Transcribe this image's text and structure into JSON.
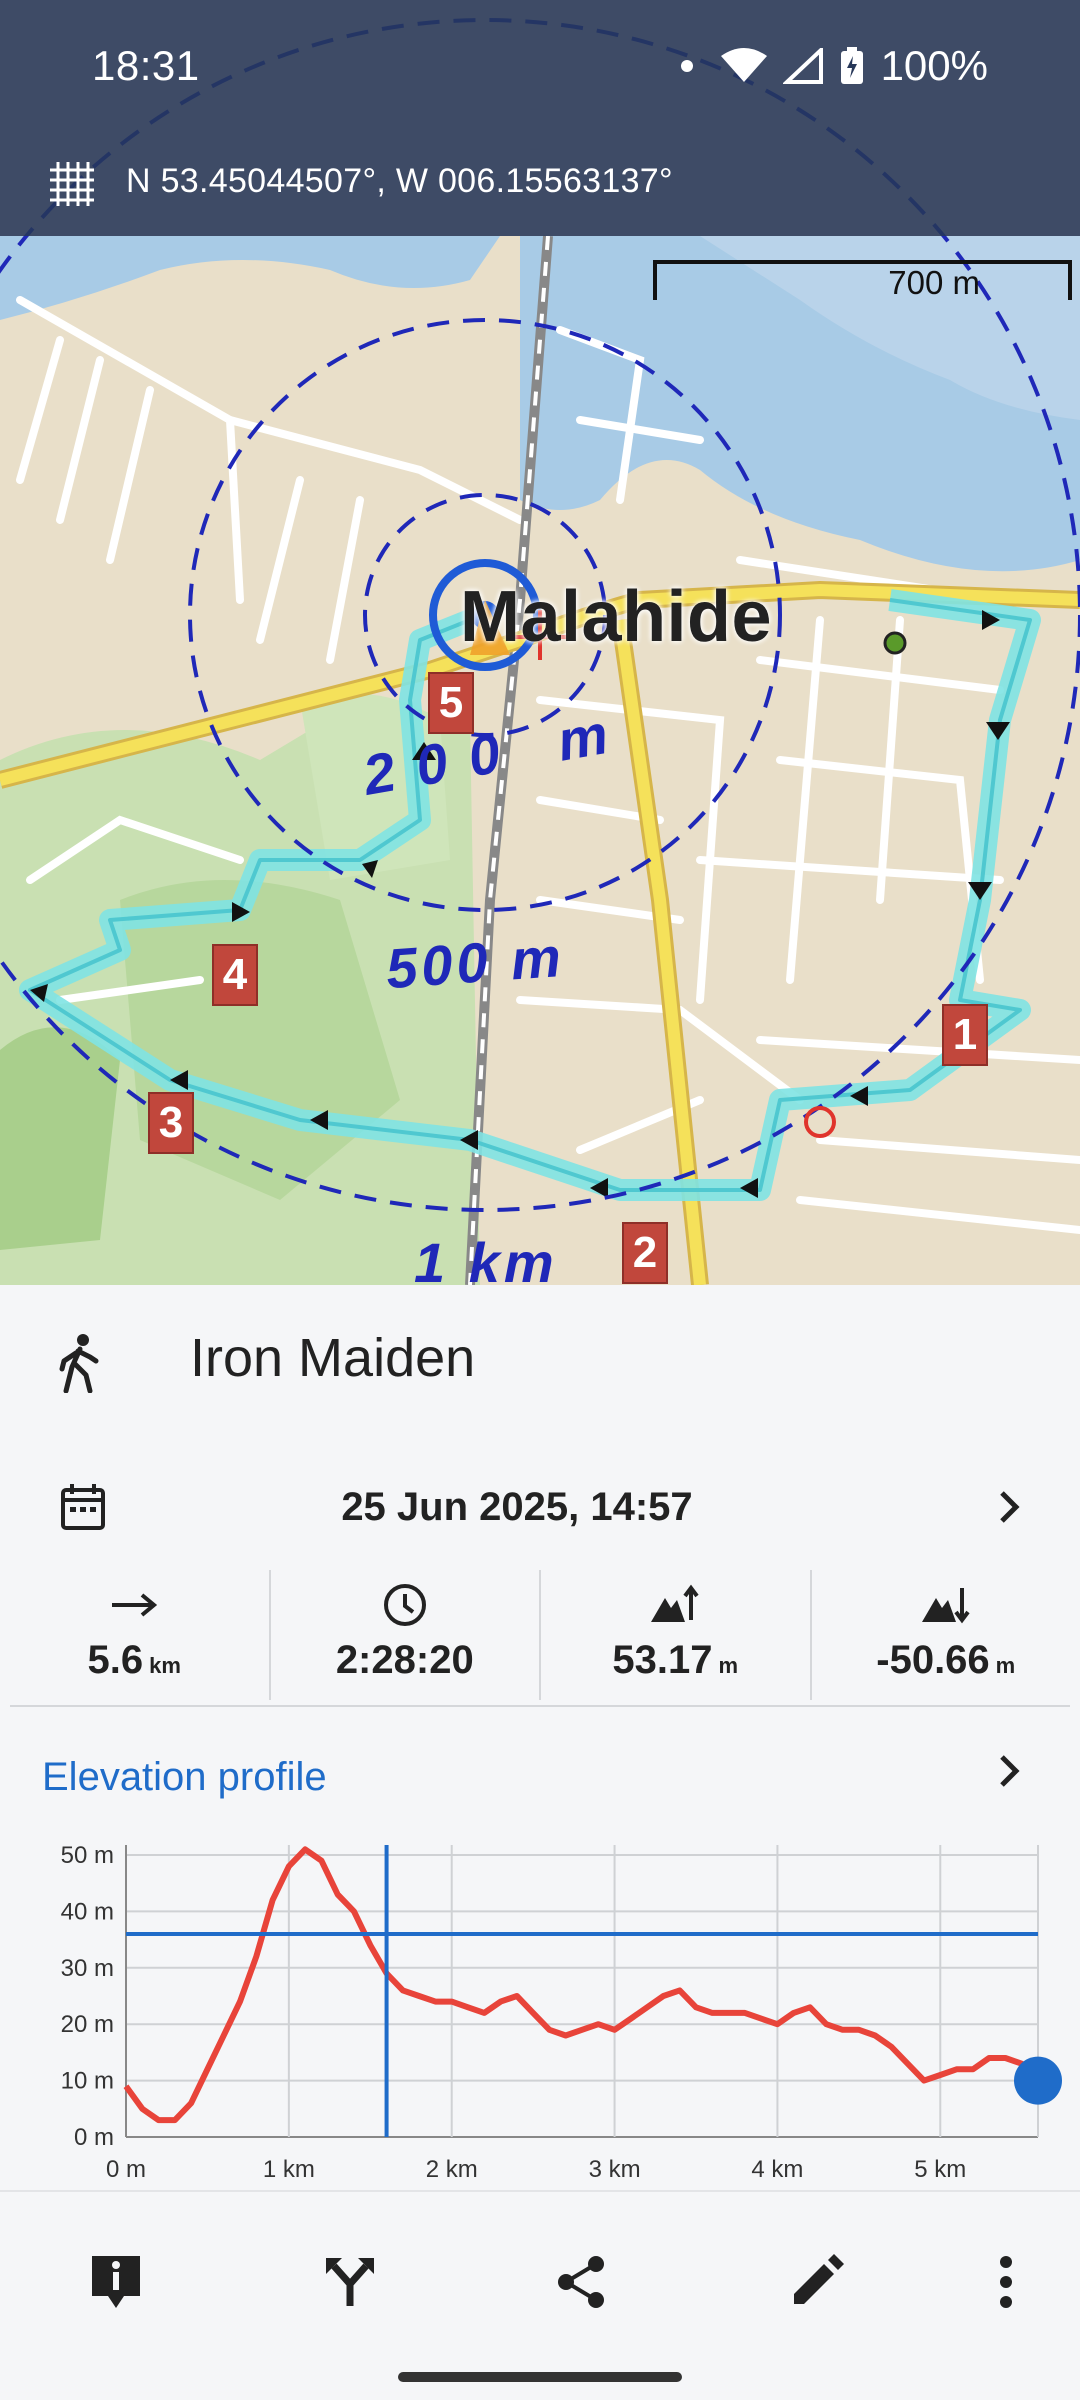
{
  "status_bar": {
    "time": "18:31",
    "battery": "100%"
  },
  "coordinates": {
    "text": "N 53.45044507°, W 006.15563137°"
  },
  "map": {
    "scale_label": "700 m",
    "town": "Malahide",
    "ring_labels": [
      "200 m",
      "500 m",
      "1 km"
    ],
    "waypoints": [
      "1",
      "2",
      "3",
      "4",
      "5"
    ],
    "colors": {
      "route": "#7fe3e3",
      "ring": "#1f28b8",
      "water": "#a8cbe6",
      "road": "#f5e15a"
    }
  },
  "track": {
    "name": "Iron Maiden",
    "activity_icon": "walking-icon",
    "date": "25 Jun 2025, 14:57"
  },
  "stats": [
    {
      "icon": "distance-arrow-icon",
      "value": "5.6",
      "unit": "km"
    },
    {
      "icon": "clock-icon",
      "value": "2:28:20",
      "unit": ""
    },
    {
      "icon": "ascent-icon",
      "value": "53.17",
      "unit": "m"
    },
    {
      "icon": "descent-icon",
      "value": "-50.66",
      "unit": "m"
    }
  ],
  "elevation": {
    "title": "Elevation profile",
    "y_ticks": [
      "50 m",
      "40 m",
      "30 m",
      "20 m",
      "10 m",
      "0 m"
    ],
    "x_ticks": [
      "0 m",
      "1 km",
      "2 km",
      "3 km",
      "4 km",
      "5 km"
    ],
    "line_color": "#e8443a",
    "cursor_color": "#1f6cc9"
  },
  "chart_data": {
    "type": "line",
    "xlabel": "",
    "ylabel": "",
    "xlim": [
      0,
      5.6
    ],
    "ylim": [
      0,
      50
    ],
    "x_unit": "km",
    "y_unit": "m",
    "series": [
      {
        "x": [
          0,
          0.1,
          0.2,
          0.3,
          0.4,
          0.5,
          0.6,
          0.7,
          0.8,
          0.9,
          1.0,
          1.1,
          1.2,
          1.3,
          1.4,
          1.5,
          1.6,
          1.7,
          1.8,
          1.9,
          2.0,
          2.1,
          2.2,
          2.3,
          2.4,
          2.5,
          2.6,
          2.7,
          2.8,
          2.9,
          3.0,
          3.1,
          3.2,
          3.3,
          3.4,
          3.5,
          3.6,
          3.7,
          3.8,
          3.9,
          4.0,
          4.1,
          4.2,
          4.3,
          4.4,
          4.5,
          4.6,
          4.7,
          4.8,
          4.9,
          5.0,
          5.1,
          5.2,
          5.3,
          5.4,
          5.5,
          5.6
        ],
        "y": [
          9,
          5,
          3,
          3,
          6,
          12,
          18,
          24,
          32,
          42,
          48,
          51,
          49,
          43,
          40,
          34,
          29,
          26,
          25,
          24,
          24,
          23,
          22,
          24,
          25,
          22,
          19,
          18,
          19,
          20,
          19,
          21,
          23,
          25,
          26,
          23,
          22,
          22,
          22,
          21,
          20,
          22,
          23,
          20,
          19,
          19,
          18,
          16,
          13,
          10,
          11,
          12,
          12,
          14,
          14,
          13,
          10
        ]
      }
    ],
    "cursor": {
      "x": 1.6,
      "y": 36
    },
    "grid": true
  },
  "nav": [
    "info-icon",
    "route-fork-icon",
    "share-icon",
    "edit-icon",
    "more-vertical-icon"
  ]
}
